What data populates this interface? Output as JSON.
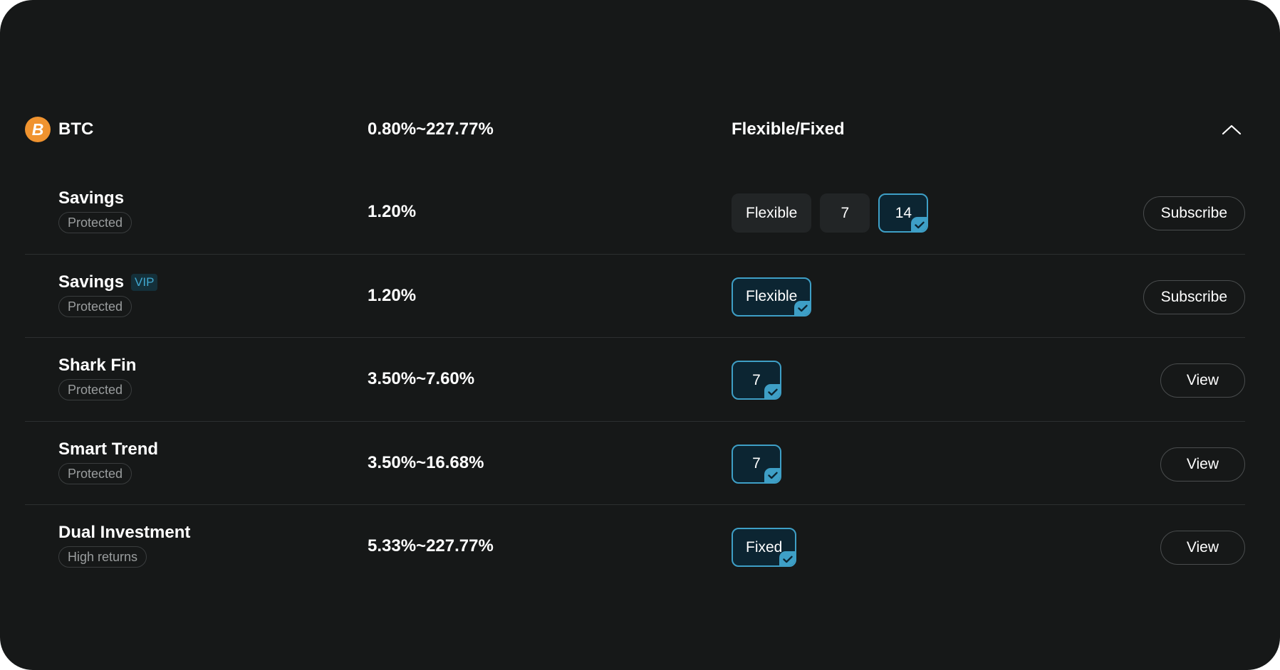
{
  "header": {
    "coin_icon": "bitcoin-icon",
    "coin_symbol": "B",
    "coin": "BTC",
    "apy_range": "0.80%~227.77%",
    "type": "Flexible/Fixed",
    "collapse_icon": "chevron-up-icon"
  },
  "products": [
    {
      "name": "Savings",
      "badge": "",
      "tag": "Protected",
      "apy": "1.20%",
      "terms": [
        {
          "label": "Flexible",
          "selected": false
        },
        {
          "label": "7",
          "selected": false
        },
        {
          "label": "14",
          "selected": true
        }
      ],
      "action": "Subscribe"
    },
    {
      "name": "Savings",
      "badge": "VIP",
      "tag": "Protected",
      "apy": "1.20%",
      "terms": [
        {
          "label": "Flexible",
          "selected": true
        }
      ],
      "action": "Subscribe"
    },
    {
      "name": "Shark Fin",
      "badge": "",
      "tag": "Protected",
      "apy": "3.50%~7.60%",
      "terms": [
        {
          "label": "7",
          "selected": true
        }
      ],
      "action": "View"
    },
    {
      "name": "Smart Trend",
      "badge": "",
      "tag": "Protected",
      "apy": "3.50%~16.68%",
      "terms": [
        {
          "label": "7",
          "selected": true
        }
      ],
      "action": "View"
    },
    {
      "name": "Dual Investment",
      "badge": "",
      "tag": "High returns",
      "apy": "5.33%~227.77%",
      "terms": [
        {
          "label": "Fixed",
          "selected": true
        }
      ],
      "action": "View"
    }
  ],
  "colors": {
    "background": "#161818",
    "accent": "#3e9fc6",
    "coin": "#f0932f",
    "vip": "#41a8d0"
  }
}
